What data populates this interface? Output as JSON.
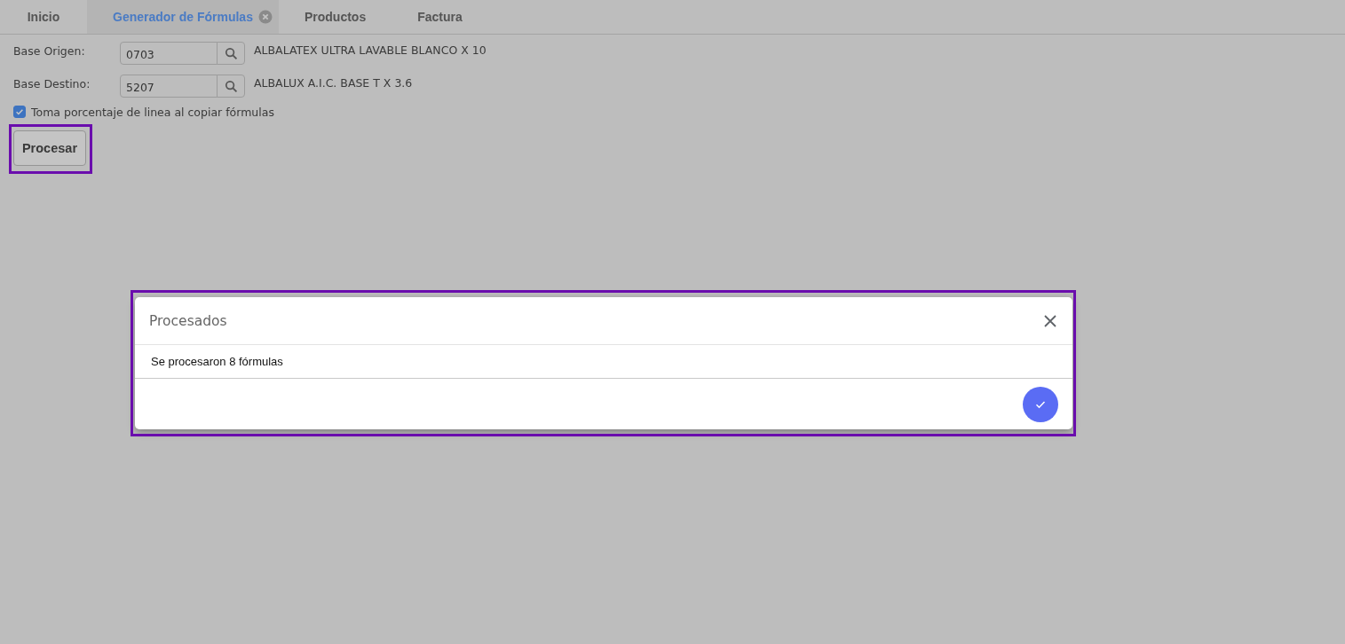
{
  "tabs": [
    {
      "label": "Inicio",
      "selected": false,
      "closable": false
    },
    {
      "label": "Generador de Fórmulas",
      "selected": true,
      "closable": true
    },
    {
      "label": "Productos",
      "selected": false,
      "closable": false
    },
    {
      "label": "Factura",
      "selected": false,
      "closable": false
    }
  ],
  "form": {
    "fields": [
      {
        "label": "Base Origen:",
        "value": "0703",
        "description": "ALBALATEX ULTRA LAVABLE BLANCO X 10"
      },
      {
        "label": "Base Destino:",
        "value": "5207",
        "description": "ALBALUX A.I.C. BASE T X 3.6"
      }
    ],
    "checkbox": {
      "label": "Toma porcentaje de linea al copiar fórmulas",
      "checked": true
    },
    "button": {
      "label": "Procesar",
      "highlighted": true
    }
  },
  "dialog": {
    "title": "Procesados",
    "message": "Se procesaron 8 fórmulas",
    "highlighted": true
  }
}
